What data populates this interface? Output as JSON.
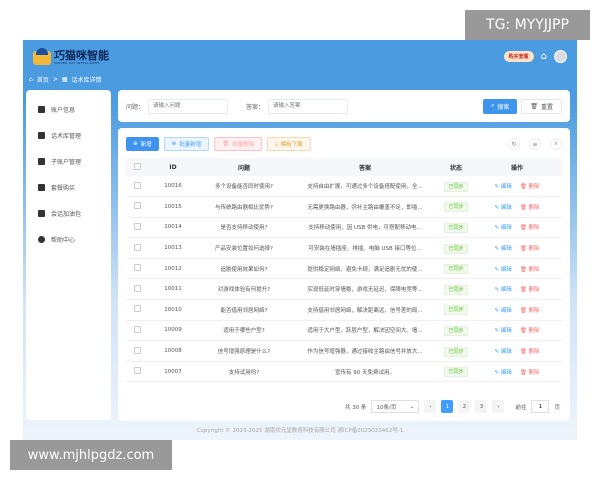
{
  "watermarks": {
    "top": "TG: MYYJJPP",
    "bottom": "www.mjhlpgdz.com"
  },
  "header": {
    "logo_title": "巧猫咪智能",
    "logo_subtitle": "CLEVER CAT INTELLIGENT",
    "buy_label": "购买套餐"
  },
  "breadcrumb": {
    "home": "首页",
    "sep": ">",
    "current": "话术库详情"
  },
  "sidebar": {
    "items": [
      {
        "label": "账户信息"
      },
      {
        "label": "话术库管理"
      },
      {
        "label": "子账户管理"
      },
      {
        "label": "套餐购买"
      },
      {
        "label": "会话加油包"
      },
      {
        "label": "帮助中心"
      }
    ]
  },
  "search": {
    "q_label": "问题：",
    "q_placeholder": "请输入问题",
    "a_label": "答案：",
    "a_placeholder": "请输入答案",
    "search_label": "搜索",
    "reset_label": "重置"
  },
  "toolbar": {
    "add": "新增",
    "batch_add": "批量新增",
    "batch_delete": "批量删除",
    "template_download": "模板下载"
  },
  "table": {
    "headers": [
      "ID",
      "问题",
      "答案",
      "状态",
      "操作"
    ],
    "rows": [
      {
        "id": "10016",
        "q": "多个设备能否同时使用?",
        "a": "支持自由扩展，可通过多个设备搭配使用，全...",
        "status": "已同步"
      },
      {
        "id": "10015",
        "q": "与传统路由器相比优势?",
        "a": "无需更换路由器，弥补主路由覆盖不足，即插...",
        "status": "已同步"
      },
      {
        "id": "10014",
        "q": "是否支持移动使用?",
        "a": "支持移动使用，因 USB 供电，可搭配移动电...",
        "status": "已同步"
      },
      {
        "id": "10013",
        "q": "产品安装位置如何选择?",
        "a": "可安装在墙插座、排插、电脑 USB 接口等位...",
        "status": "已同步"
      },
      {
        "id": "10012",
        "q": "追剧使用效果如何?",
        "a": "提供稳定网络，避免卡顿，满足追剧无忧的使...",
        "status": "已同步"
      },
      {
        "id": "10011",
        "q": "对游戏体验有何提升?",
        "a": "实现低延时穿墙稳，游戏无延迟，保障电竞等...",
        "status": "已同步"
      },
      {
        "id": "10010",
        "q": "能否借用邻居网络?",
        "a": "支持借用邻居网络，解决距离远、信号差的局...",
        "status": "已同步"
      },
      {
        "id": "10009",
        "q": "适用于哪些户型?",
        "a": "适用于大户型、跃层户型，解决因空间大、墙...",
        "status": "已同步"
      },
      {
        "id": "10008",
        "q": "信号增强原理是什么?",
        "a": "作为信号增强器，通过接收主路由信号并放大...",
        "status": "已同步"
      },
      {
        "id": "10007",
        "q": "支持试用吗?",
        "a": "宣传有 90 天免费试用。",
        "status": "已同步"
      }
    ],
    "edit_label": "编辑",
    "delete_label": "删除"
  },
  "pagination": {
    "total": "共 30 条",
    "page_size": "10条/页",
    "pages": [
      "1",
      "2",
      "3"
    ],
    "current_page": 1,
    "goto_label": "前往",
    "goto_value": "1",
    "page_unit": "页"
  },
  "footer": {
    "copyright": "Copyright © 2023-2025 湖南状元堂教育科技有限公司 湘ICP备2023023462号-1"
  }
}
